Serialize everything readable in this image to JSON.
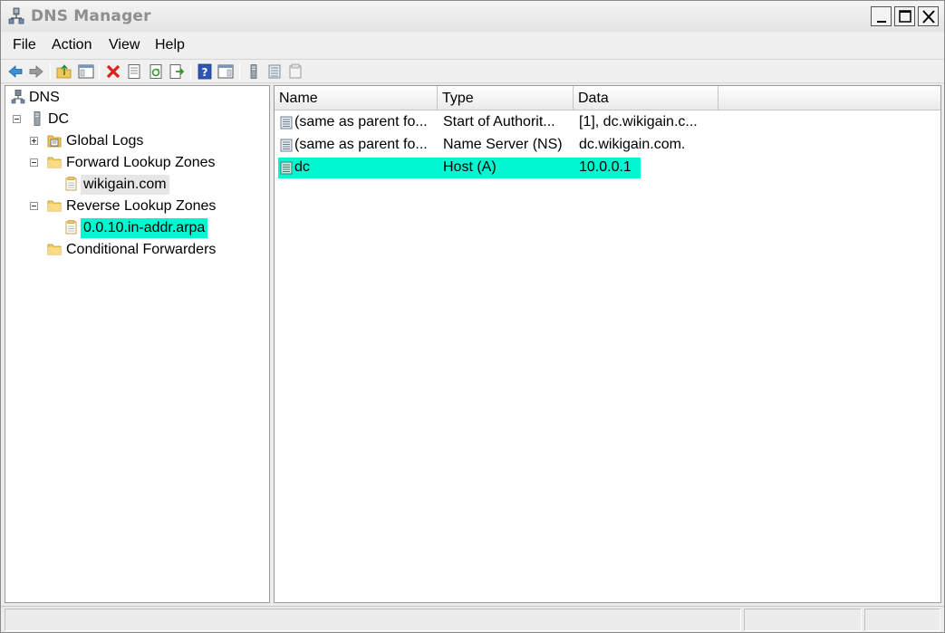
{
  "window": {
    "title": "DNS Manager",
    "icon": "dns-server-icon",
    "controls": [
      "minimize-icon",
      "maximize-icon",
      "close-icon"
    ]
  },
  "menu": {
    "items": [
      "File",
      "Action",
      "View",
      "Help"
    ]
  },
  "toolbar": {
    "buttons": [
      "back-arrow-icon",
      "forward-arrow-icon",
      "up-folder-icon",
      "show-hide-console-tree-icon",
      "delete-icon",
      "properties-icon",
      "refresh-icon",
      "export-list-icon",
      "help-icon",
      "action-pane-icon",
      "server-icon",
      "record-icon",
      "zone-icon"
    ]
  },
  "tree": {
    "nodes": [
      {
        "label": "DNS",
        "icon": "dns-root-icon",
        "expander": "none"
      },
      {
        "label": "DC",
        "icon": "server-icon",
        "expander": "collapse"
      },
      {
        "label": "Global Logs",
        "icon": "logs-folder-icon",
        "expander": "expand"
      },
      {
        "label": "Forward Lookup Zones",
        "icon": "folder-icon",
        "expander": "collapse"
      },
      {
        "label": "wikigain.com",
        "icon": "zone-icon",
        "expander": "none",
        "state": "selected-inactive"
      },
      {
        "label": "Reverse Lookup Zones",
        "icon": "folder-icon",
        "expander": "collapse"
      },
      {
        "label": "0.0.10.in-addr.arpa",
        "icon": "zone-icon",
        "expander": "none",
        "state": "highlighted"
      },
      {
        "label": "Conditional Forwarders",
        "icon": "folder-icon",
        "expander": "none"
      }
    ]
  },
  "list": {
    "columns": [
      "Name",
      "Type",
      "Data"
    ],
    "rows": [
      {
        "name": "(same as parent fo...",
        "type": "Start of Authorit...",
        "data": "[1], dc.wikigain.c...",
        "icon": "record-icon"
      },
      {
        "name": "(same as parent fo...",
        "type": "Name Server (NS)",
        "data": "dc.wikigain.com.",
        "icon": "record-icon"
      },
      {
        "name": "dc",
        "type": "Host (A)",
        "data": "10.0.0.1",
        "icon": "host-record-icon",
        "state": "highlighted"
      }
    ]
  },
  "status": {
    "cells": [
      "",
      "",
      ""
    ]
  },
  "colors": {
    "highlight": "#00f7cf",
    "selected_inactive": "#e6e6e6",
    "title_text": "#8e8e8e"
  }
}
